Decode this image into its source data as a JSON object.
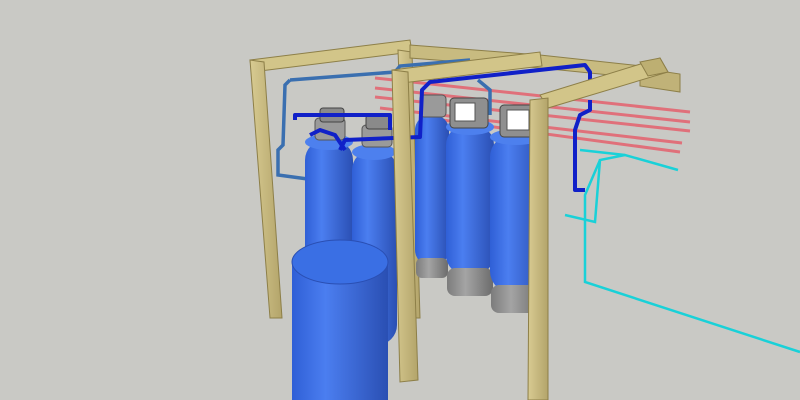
{
  "scene": {
    "description_visible_text": "",
    "colors": {
      "background": "#c9c9c5",
      "wood": "#cdbf86",
      "wood_dark": "#a99a5c",
      "tank_blue": "#3f70e0",
      "tank_blue_dark": "#2a4fb3",
      "tank_base": "#8e8e8e",
      "valve_head": "#9a9a9a",
      "pipe_dark_blue": "#1020c8",
      "pipe_mid_blue": "#3a6fb0",
      "pipe_cyan": "#19d1d8",
      "pipe_red": "#e0707a"
    }
  }
}
